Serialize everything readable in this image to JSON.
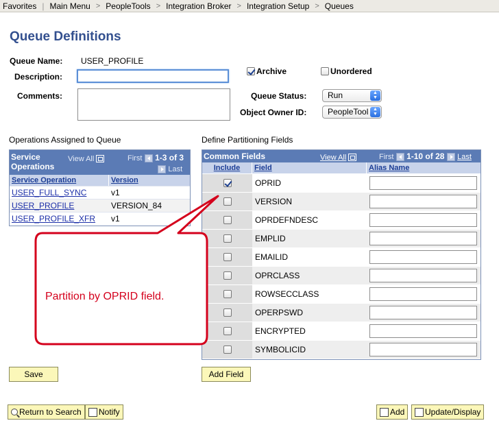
{
  "breadcrumb": [
    "Favorites",
    "Main Menu",
    "PeopleTools",
    "Integration Broker",
    "Integration Setup",
    "Queues"
  ],
  "page_title": "Queue Definitions",
  "form": {
    "queue_name_label": "Queue Name:",
    "queue_name_value": "USER_PROFILE",
    "description_label": "Description:",
    "description_value": "",
    "comments_label": "Comments:",
    "comments_value": "",
    "archive_label": "Archive",
    "archive_checked": true,
    "unordered_label": "Unordered",
    "unordered_checked": false,
    "queue_status_label": "Queue Status:",
    "queue_status_value": "Run",
    "object_owner_label": "Object Owner ID:",
    "object_owner_value": "PeopleTool"
  },
  "operations": {
    "section_title": "Operations Assigned to Queue",
    "grid_title": "Service Operations",
    "view_all": "View All",
    "first": "First",
    "range": "1-3 of 3",
    "last": "Last",
    "col_operation": "Service Operation",
    "col_version": "Version",
    "rows": [
      {
        "operation": "USER_FULL_SYNC",
        "version": "v1"
      },
      {
        "operation": "USER_PROFILE",
        "version": "VERSION_84"
      },
      {
        "operation": "USER_PROFILE_XFR",
        "version": "v1"
      }
    ]
  },
  "partition": {
    "section_title": "Define Partitioning Fields",
    "grid_title": "Common Fields",
    "view_all": "View All",
    "first": "First",
    "range": "1-10 of 28",
    "last": "Last",
    "col_include": "Include",
    "col_field": "Field",
    "col_alias": "Alias Name",
    "rows": [
      {
        "field": "OPRID",
        "checked": true
      },
      {
        "field": "VERSION",
        "checked": false
      },
      {
        "field": "OPRDEFNDESC",
        "checked": false
      },
      {
        "field": "EMPLID",
        "checked": false
      },
      {
        "field": "EMAILID",
        "checked": false
      },
      {
        "field": "OPRCLASS",
        "checked": false
      },
      {
        "field": "ROWSECCLASS",
        "checked": false
      },
      {
        "field": "OPERPSWD",
        "checked": false
      },
      {
        "field": "ENCRYPTED",
        "checked": false
      },
      {
        "field": "SYMBOLICID",
        "checked": false
      }
    ]
  },
  "callout_text": "Partition by OPRID field.",
  "buttons": {
    "save": "Save",
    "add_field": "Add Field",
    "return_to_search": "Return to Search",
    "notify": "Notify",
    "add": "Add",
    "update_display": "Update/Display"
  },
  "colors": {
    "title_blue": "#33508f",
    "grid_header": "#5b7bb5",
    "button_yellow": "#fbf7b9",
    "callout_red": "#d4001c"
  }
}
